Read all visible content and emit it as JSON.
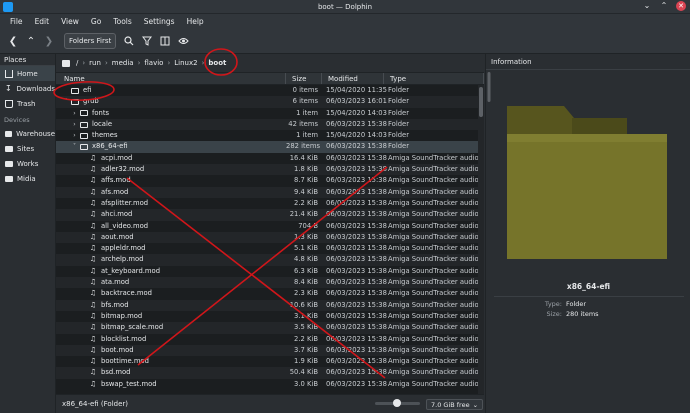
{
  "window": {
    "title": "boot — Dolphin"
  },
  "menu": [
    "File",
    "Edit",
    "View",
    "Go",
    "Tools",
    "Settings",
    "Help"
  ],
  "toolbar": {
    "folders_first_label": "Folders First"
  },
  "places": {
    "header": "Places",
    "items": [
      {
        "label": "Home",
        "icon": "home-icon"
      },
      {
        "label": "Downloads",
        "icon": "download-icon"
      },
      {
        "label": "Trash",
        "icon": "trash-icon"
      }
    ],
    "devices_header": "Devices",
    "devices": [
      "Warehouse",
      "Sites",
      "Works",
      "Midia"
    ]
  },
  "breadcrumb": [
    "/",
    "run",
    "media",
    "flavio",
    "Linux2",
    "boot"
  ],
  "columns": {
    "name": "Name",
    "size": "Size",
    "modified": "Modified",
    "type": "Type"
  },
  "rows": [
    {
      "name": "efi",
      "size": "0 items",
      "modified": "15/04/2020 11:35",
      "type": "Folder",
      "kind": "folder",
      "indent": 0,
      "expander": ""
    },
    {
      "name": "grub",
      "size": "6 items",
      "modified": "06/03/2023 16:01",
      "type": "Folder",
      "kind": "folder",
      "indent": 0,
      "expander": "v"
    },
    {
      "name": "fonts",
      "size": "1 item",
      "modified": "15/04/2020 14:03",
      "type": "Folder",
      "kind": "folder",
      "indent": 1,
      "expander": ">"
    },
    {
      "name": "locale",
      "size": "42 items",
      "modified": "06/03/2023 15:38",
      "type": "Folder",
      "kind": "folder",
      "indent": 1,
      "expander": ">"
    },
    {
      "name": "themes",
      "size": "1 item",
      "modified": "15/04/2020 14:03",
      "type": "Folder",
      "kind": "folder",
      "indent": 1,
      "expander": ">"
    },
    {
      "name": "x86_64-efi",
      "size": "282 items",
      "modified": "06/03/2023 15:38",
      "type": "Folder",
      "kind": "folder",
      "indent": 1,
      "expander": "v",
      "selected": true
    },
    {
      "name": "acpi.mod",
      "size": "16.4 KiB",
      "modified": "06/03/2023 15:38",
      "type": "Amiga SoundTracker audio",
      "kind": "file",
      "indent": 2
    },
    {
      "name": "adler32.mod",
      "size": "1.8 KiB",
      "modified": "06/03/2023 15:38",
      "type": "Amiga SoundTracker audio",
      "kind": "file",
      "indent": 2
    },
    {
      "name": "affs.mod",
      "size": "8.7 KiB",
      "modified": "06/03/2023 15:38",
      "type": "Amiga SoundTracker audio",
      "kind": "file",
      "indent": 2
    },
    {
      "name": "afs.mod",
      "size": "9.4 KiB",
      "modified": "06/03/2023 15:38",
      "type": "Amiga SoundTracker audio",
      "kind": "file",
      "indent": 2
    },
    {
      "name": "afsplitter.mod",
      "size": "2.2 KiB",
      "modified": "06/03/2023 15:38",
      "type": "Amiga SoundTracker audio",
      "kind": "file",
      "indent": 2
    },
    {
      "name": "ahci.mod",
      "size": "21.4 KiB",
      "modified": "06/03/2023 15:38",
      "type": "Amiga SoundTracker audio",
      "kind": "file",
      "indent": 2
    },
    {
      "name": "all_video.mod",
      "size": "704 B",
      "modified": "06/03/2023 15:38",
      "type": "Amiga SoundTracker audio",
      "kind": "file",
      "indent": 2
    },
    {
      "name": "aout.mod",
      "size": "1.3 KiB",
      "modified": "06/03/2023 15:38",
      "type": "Amiga SoundTracker audio",
      "kind": "file",
      "indent": 2
    },
    {
      "name": "appleldr.mod",
      "size": "5.1 KiB",
      "modified": "06/03/2023 15:38",
      "type": "Amiga SoundTracker audio",
      "kind": "file",
      "indent": 2
    },
    {
      "name": "archelp.mod",
      "size": "4.8 KiB",
      "modified": "06/03/2023 15:38",
      "type": "Amiga SoundTracker audio",
      "kind": "file",
      "indent": 2
    },
    {
      "name": "at_keyboard.mod",
      "size": "6.3 KiB",
      "modified": "06/03/2023 15:38",
      "type": "Amiga SoundTracker audio",
      "kind": "file",
      "indent": 2
    },
    {
      "name": "ata.mod",
      "size": "8.4 KiB",
      "modified": "06/03/2023 15:38",
      "type": "Amiga SoundTracker audio",
      "kind": "file",
      "indent": 2
    },
    {
      "name": "backtrace.mod",
      "size": "2.3 KiB",
      "modified": "06/03/2023 15:38",
      "type": "Amiga SoundTracker audio",
      "kind": "file",
      "indent": 2
    },
    {
      "name": "bfs.mod",
      "size": "10.6 KiB",
      "modified": "06/03/2023 15:38",
      "type": "Amiga SoundTracker audio",
      "kind": "file",
      "indent": 2
    },
    {
      "name": "bitmap.mod",
      "size": "3.1 KiB",
      "modified": "06/03/2023 15:38",
      "type": "Amiga SoundTracker audio",
      "kind": "file",
      "indent": 2
    },
    {
      "name": "bitmap_scale.mod",
      "size": "3.5 KiB",
      "modified": "06/03/2023 15:38",
      "type": "Amiga SoundTracker audio",
      "kind": "file",
      "indent": 2
    },
    {
      "name": "blocklist.mod",
      "size": "2.2 KiB",
      "modified": "06/03/2023 15:38",
      "type": "Amiga SoundTracker audio",
      "kind": "file",
      "indent": 2
    },
    {
      "name": "boot.mod",
      "size": "3.7 KiB",
      "modified": "06/03/2023 15:38",
      "type": "Amiga SoundTracker audio",
      "kind": "file",
      "indent": 2
    },
    {
      "name": "boottime.mod",
      "size": "1.9 KiB",
      "modified": "06/03/2023 15:38",
      "type": "Amiga SoundTracker audio",
      "kind": "file",
      "indent": 2
    },
    {
      "name": "bsd.mod",
      "size": "50.4 KiB",
      "modified": "06/03/2023 15:38",
      "type": "Amiga SoundTracker audio",
      "kind": "file",
      "indent": 2
    },
    {
      "name": "bswap_test.mod",
      "size": "3.0 KiB",
      "modified": "06/03/2023 15:38",
      "type": "Amiga SoundTracker audio",
      "kind": "file",
      "indent": 2
    }
  ],
  "status": {
    "text": "x86_64-efi (Folder)",
    "free_space": "7.0 GiB free"
  },
  "info": {
    "header": "Information",
    "name": "x86_64-efi",
    "type_label": "Type:",
    "type_value": "Folder",
    "size_label": "Size:",
    "size_value": "280 items"
  },
  "colors": {
    "accent": "#1d99f3",
    "annotation": "#d0161a",
    "folder": "#6f6d26"
  }
}
